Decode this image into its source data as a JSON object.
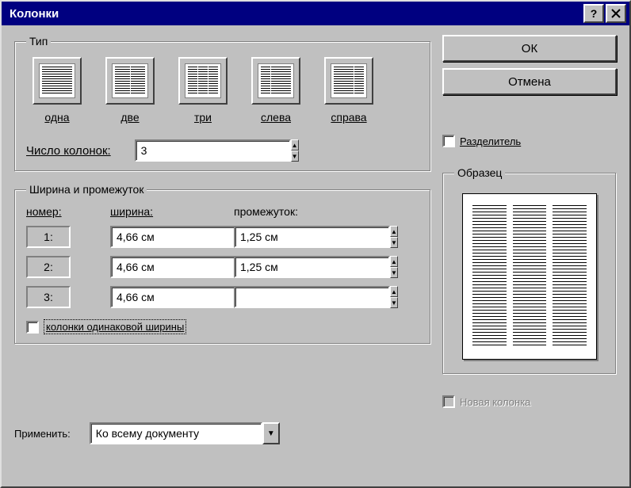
{
  "window_title": "Колонки",
  "buttons": {
    "ok": "ОК",
    "cancel": "Отмена"
  },
  "type": {
    "legend": "Тип",
    "presets": [
      {
        "label": "одна",
        "cols": [
          1
        ]
      },
      {
        "label": "две",
        "cols": [
          1,
          1
        ]
      },
      {
        "label": "три",
        "cols": [
          1,
          1,
          1
        ]
      },
      {
        "label": "слева",
        "cols": [
          1,
          2
        ]
      },
      {
        "label": "справа",
        "cols": [
          2,
          1
        ]
      }
    ]
  },
  "num_columns": {
    "label": "Число колонок:",
    "value": "3"
  },
  "separator": {
    "label": "Разделитель",
    "checked": false
  },
  "width_spacing": {
    "legend": "Ширина и промежуток",
    "headers": {
      "number": "номер:",
      "width": "ширина:",
      "spacing": "промежуток:"
    },
    "rows": [
      {
        "num": "1:",
        "width": "4,66 см",
        "spacing": "1,25 см"
      },
      {
        "num": "2:",
        "width": "4,66 см",
        "spacing": "1,25 см"
      },
      {
        "num": "3:",
        "width": "4,66 см",
        "spacing": ""
      }
    ],
    "equal": {
      "label": "колонки одинаковой ширины",
      "checked": false
    }
  },
  "preview": {
    "legend": "Образец",
    "columns": 3
  },
  "new_column": {
    "label": "Новая колонка",
    "enabled": false
  },
  "apply": {
    "label": "Применить:",
    "value": "Ко всему документу"
  }
}
